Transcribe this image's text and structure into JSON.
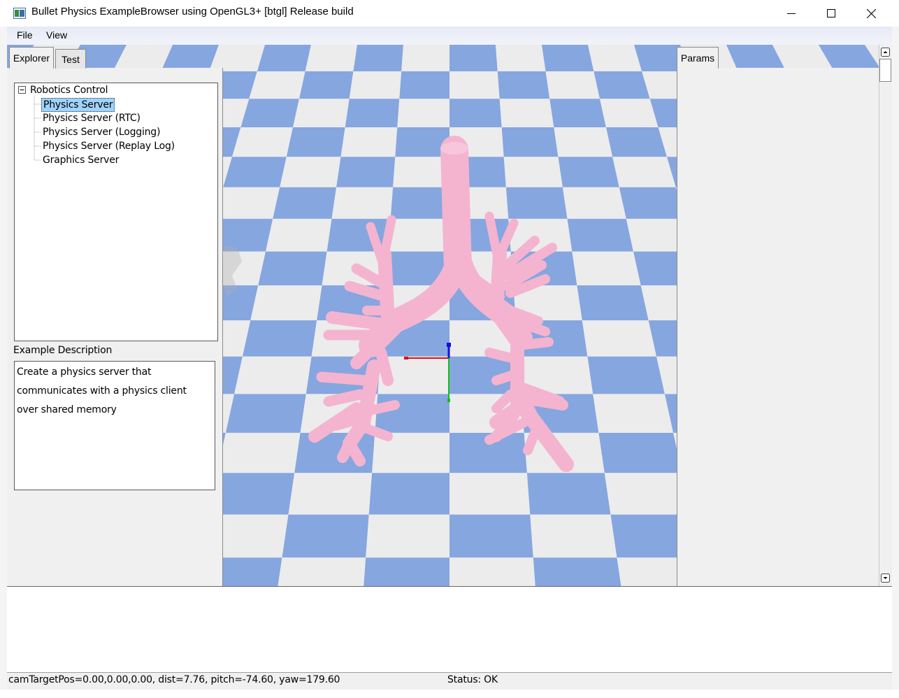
{
  "window": {
    "title": "Bullet Physics ExampleBrowser using OpenGL3+ [btgl] Release build",
    "minimize_label": "minimize",
    "maximize_label": "maximize",
    "close_label": "close"
  },
  "menu": {
    "items": [
      "File",
      "View"
    ]
  },
  "left_panel": {
    "tabs": [
      "Explorer",
      "Test"
    ],
    "active_tab": "Explorer",
    "tree": {
      "root": "Robotics Control",
      "root_expanded": true,
      "items": [
        "Physics Server",
        "Physics Server (RTC)",
        "Physics Server (Logging)",
        "Physics Server (Replay Log)",
        "Graphics Server"
      ],
      "selected": "Physics Server"
    },
    "description_label": "Example Description",
    "description_lines": [
      "Create a physics server that",
      "communicates with a physics client",
      "over shared memory"
    ]
  },
  "right_panel": {
    "tabs": [
      "Params"
    ]
  },
  "status": {
    "camera": "camTargetPos=0.00,0.00,0.00, dist=7.76, pitch=-74.60, yaw=179.60",
    "status": "Status: OK"
  },
  "colors": {
    "floor_blue": "#86a6e0",
    "floor_light": "#ececec",
    "model_pink": "#f4b4cf",
    "selection": "#9fd3fb",
    "axis_x": "#e01010",
    "axis_y": "#10c010",
    "axis_z": "#1010e0"
  },
  "icons": [
    "app-icon",
    "minimize-icon",
    "maximize-icon",
    "close-icon",
    "tree-collapse-icon",
    "scroll-up-icon",
    "scroll-down-icon"
  ]
}
